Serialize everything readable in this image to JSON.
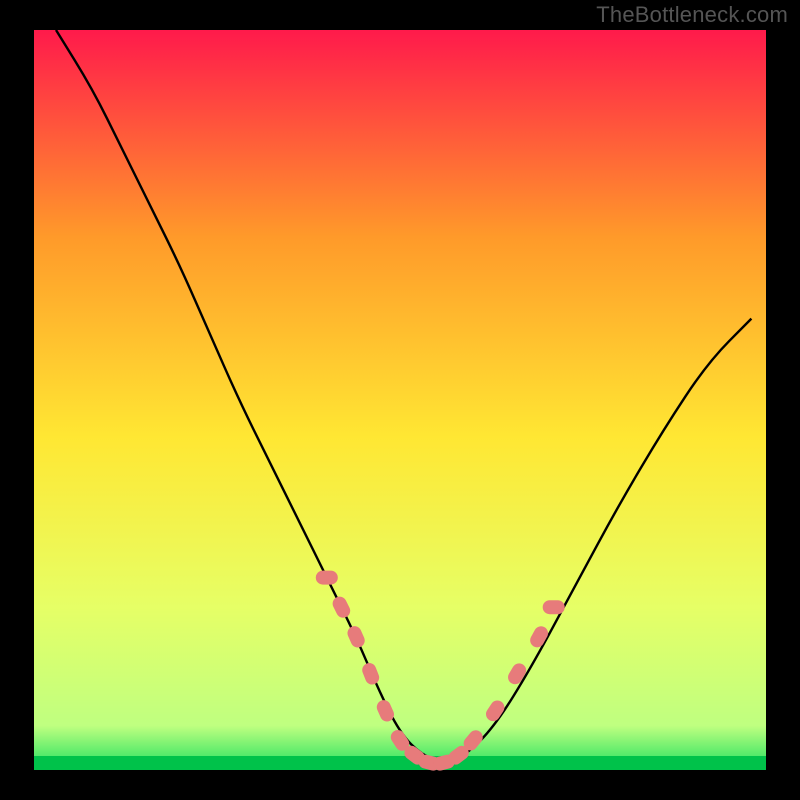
{
  "watermark": "TheBottleneck.com",
  "chart_data": {
    "type": "line",
    "title": "",
    "xlabel": "",
    "ylabel": "",
    "xlim": [
      0,
      100
    ],
    "ylim": [
      0,
      100
    ],
    "background_gradient": {
      "top": "#ff1a4b",
      "q1": "#ff9a2a",
      "mid": "#ffe733",
      "q3": "#e6ff66",
      "bottom_band": "#20e060",
      "bottom_edge": "#00c24a"
    },
    "series": [
      {
        "name": "bottleneck-curve",
        "type": "line",
        "color": "#000000",
        "x": [
          3,
          8,
          12,
          16,
          20,
          24,
          28,
          32,
          36,
          40,
          44,
          47,
          50,
          53,
          56,
          59,
          63,
          68,
          74,
          80,
          86,
          92,
          98
        ],
        "y": [
          100,
          92,
          84,
          76,
          68,
          59,
          50,
          42,
          34,
          26,
          18,
          11,
          5,
          2,
          1,
          2,
          6,
          14,
          25,
          36,
          46,
          55,
          61
        ]
      },
      {
        "name": "markers",
        "type": "scatter",
        "color": "#e77b7b",
        "x": [
          40,
          42,
          44,
          46,
          48,
          50,
          52,
          54,
          56,
          58,
          60,
          63,
          66,
          69,
          71
        ],
        "y": [
          26,
          22,
          18,
          13,
          8,
          4,
          2,
          1,
          1,
          2,
          4,
          8,
          13,
          18,
          22
        ]
      }
    ]
  }
}
